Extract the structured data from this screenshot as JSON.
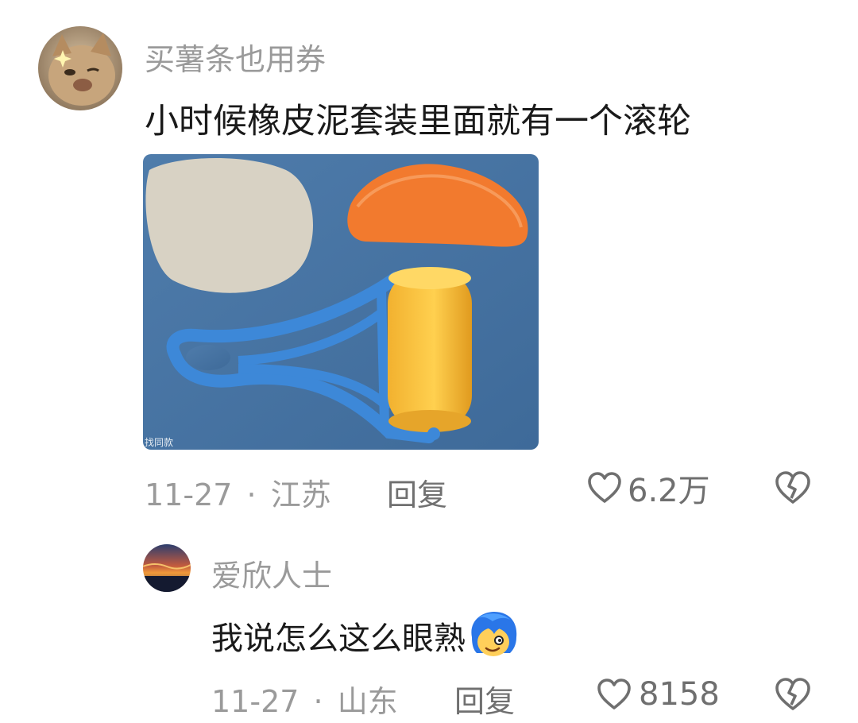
{
  "comment": {
    "username": "买薯条也用券",
    "text": "小时候橡皮泥套装里面就有一个滚轮",
    "image_caption": "找同款",
    "date": "11-27",
    "separator": "·",
    "location": "江苏",
    "reply_label": "回复",
    "like_count": "6.2万",
    "icons": {
      "like": "heart-outline-icon",
      "dislike": "broken-heart-icon"
    }
  },
  "reply": {
    "username": "爱欣人士",
    "text": "我说怎么这么眼熟",
    "emoji": "blue-hair-face-emoji",
    "date": "11-27",
    "separator": "·",
    "location": "山东",
    "reply_label": "回复",
    "like_count": "8158",
    "icons": {
      "like": "heart-outline-icon",
      "dislike": "broken-heart-icon"
    }
  },
  "colors": {
    "meta_text": "#9a9a9a",
    "content_text": "#1a1a1a",
    "icon": "#6f6f6f"
  }
}
